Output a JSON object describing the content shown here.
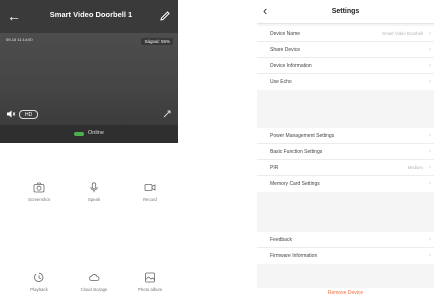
{
  "left": {
    "title": "Smart Video Doorbell 1",
    "video": {
      "timestamp": "09-16 11:14:00",
      "resolution": "Ságnal: 55%",
      "hd_label": "HD"
    },
    "status": {
      "text": "Online",
      "color": "#4caf50"
    },
    "controls": [
      {
        "icon": "camera-icon",
        "label": "Screenshot"
      },
      {
        "icon": "microphone-icon",
        "label": "Speak"
      },
      {
        "icon": "video-record-icon",
        "label": "Record"
      },
      {
        "icon": "playback-icon",
        "label": "Playback"
      },
      {
        "icon": "cloud-storage-icon",
        "label": "Cloud storage"
      },
      {
        "icon": "photo-album-icon",
        "label": "Photo album"
      }
    ]
  },
  "right": {
    "title": "Settings",
    "groups": [
      [
        {
          "label": "Device Name",
          "value": "Smart Video Doorbell"
        },
        {
          "label": "Share Device",
          "value": ""
        },
        {
          "label": "Device Information",
          "value": ""
        },
        {
          "label": "Use Echo",
          "value": ""
        }
      ],
      [
        {
          "label": "Power Management Settings",
          "value": ""
        },
        {
          "label": "Basic Function Settings",
          "value": ""
        },
        {
          "label": "PIR",
          "value": "Medium"
        },
        {
          "label": "Memory Card Settings",
          "value": ""
        }
      ],
      [
        {
          "label": "Feedback",
          "value": ""
        },
        {
          "label": "Firmware Information",
          "value": ""
        }
      ]
    ],
    "remove_label": "Remove Device"
  },
  "colors": {
    "accent": "#f06a3a",
    "header_dark": "#3a3a3a",
    "online": "#4caf50"
  }
}
